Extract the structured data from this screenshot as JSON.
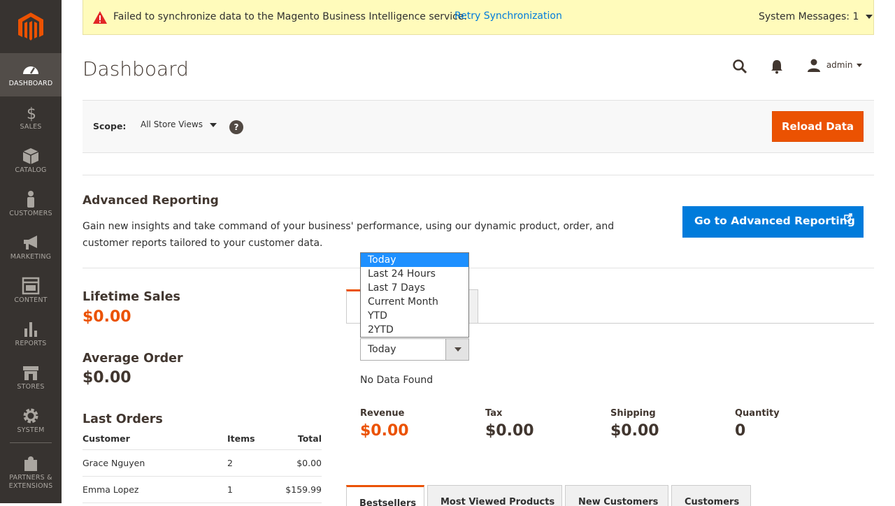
{
  "sidebar": {
    "logo": "magento-logo",
    "items": [
      {
        "label": "Dashboard",
        "icon": "speedometer-icon",
        "active": true
      },
      {
        "label": "Sales",
        "icon": "dollar-icon"
      },
      {
        "label": "Catalog",
        "icon": "box-icon"
      },
      {
        "label": "Customers",
        "icon": "person-icon"
      },
      {
        "label": "Marketing",
        "icon": "megaphone-icon"
      },
      {
        "label": "Content",
        "icon": "layout-icon"
      },
      {
        "label": "Reports",
        "icon": "bar-chart-icon"
      },
      {
        "label": "Stores",
        "icon": "store-icon"
      },
      {
        "label": "System",
        "icon": "gear-icon"
      },
      {
        "label": "Partners & Extensions",
        "icon": "puzzle-icon"
      }
    ]
  },
  "system_message": {
    "text": "Failed to synchronize data to the Magento Business Intelligence service.",
    "retry_link": "Retry Synchronization",
    "messages_label": "System Messages: 1"
  },
  "header": {
    "title": "Dashboard",
    "user": "admin"
  },
  "scope": {
    "label": "Scope:",
    "value": "All Store Views",
    "help": "?",
    "reload_button": "Reload Data"
  },
  "advanced_reporting": {
    "title": "Advanced Reporting",
    "description": "Gain new insights and take command of your business' performance, using our dynamic product, order, and customer reports tailored to your customer data.",
    "button": "Go to Advanced Reporting"
  },
  "stats": {
    "lifetime_sales_label": "Lifetime Sales",
    "lifetime_sales_value": "$0.00",
    "average_order_label": "Average Order",
    "average_order_value": "$0.00"
  },
  "last_orders": {
    "title": "Last Orders",
    "columns": [
      "Customer",
      "Items",
      "Total"
    ],
    "rows": [
      {
        "customer": "Grace Nguyen",
        "items": "2",
        "total": "$0.00"
      },
      {
        "customer": "Emma Lopez",
        "items": "1",
        "total": "$159.99"
      }
    ]
  },
  "period": {
    "selected": "Today",
    "options": [
      "Today",
      "Last 24 Hours",
      "Last 7 Days",
      "Current Month",
      "YTD",
      "2YTD"
    ],
    "no_data": "No Data Found"
  },
  "totals": [
    {
      "label": "Revenue",
      "value": "$0.00"
    },
    {
      "label": "Tax",
      "value": "$0.00"
    },
    {
      "label": "Shipping",
      "value": "$0.00"
    },
    {
      "label": "Quantity",
      "value": "0"
    }
  ],
  "grid_tabs": [
    "Bestsellers",
    "Most Viewed Products",
    "New Customers",
    "Customers"
  ],
  "colors": {
    "sidebar_bg": "#373330",
    "accent_orange": "#eb5202",
    "link_blue": "#007bdb",
    "warning_bg": "#fffbbb"
  }
}
